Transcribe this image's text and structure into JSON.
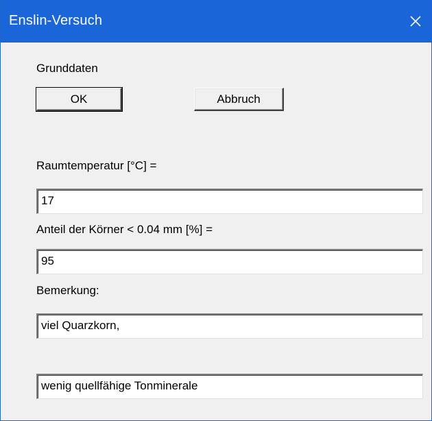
{
  "window": {
    "title": "Enslin-Versuch",
    "titlebar_color": "#1a66d8",
    "close_icon": "close-icon"
  },
  "section": {
    "heading": "Grunddaten"
  },
  "buttons": {
    "ok_label": "OK",
    "cancel_label": "Abbruch"
  },
  "fields": {
    "room_temp_label": "Raumtemperatur [°C] =",
    "room_temp_value": "17",
    "grain_share_label": "Anteil der Körner < 0.04 mm [%] =",
    "grain_share_value": "95",
    "remark_label": "Bemerkung:",
    "remark_line1": "viel Quarzkorn,",
    "remark_line2": "wenig quellfähige Tonminerale"
  }
}
